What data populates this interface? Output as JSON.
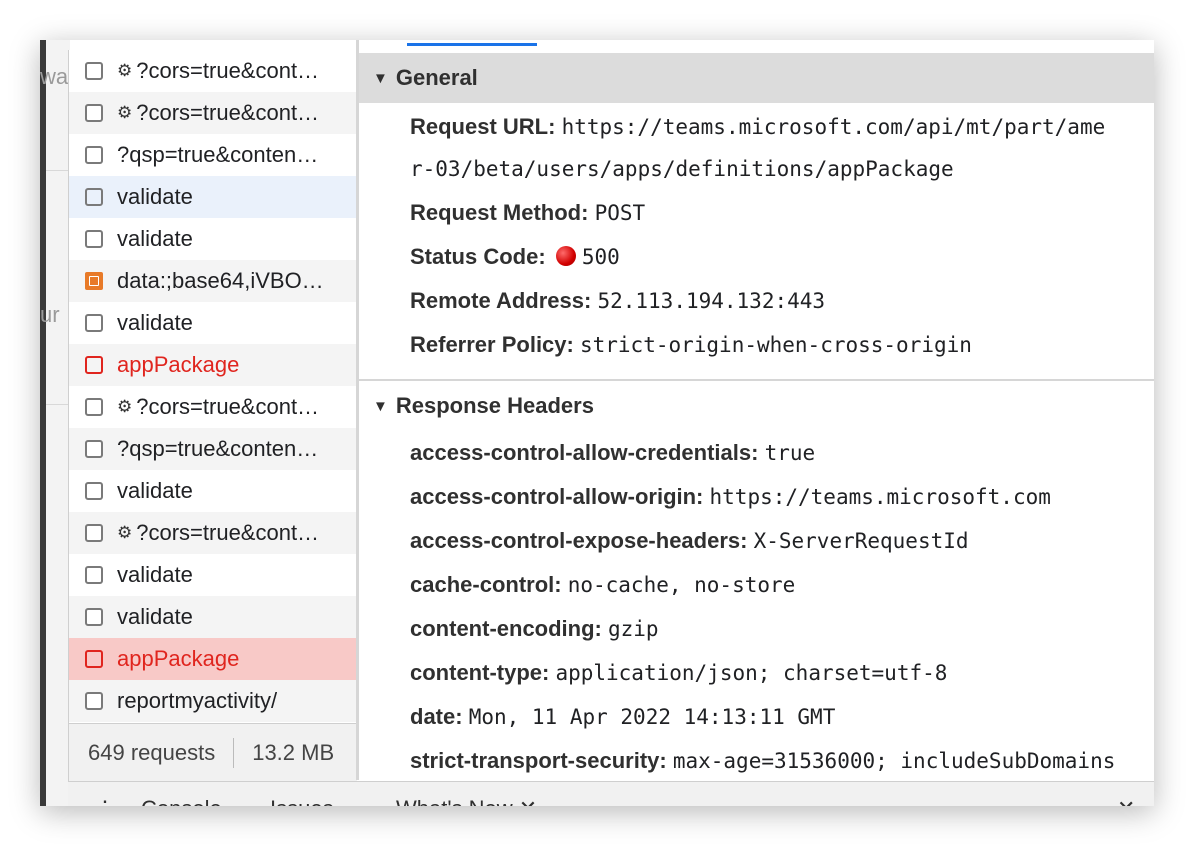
{
  "background": {
    "frag_top": "wa",
    "frag_mid": "ur"
  },
  "request_list": [
    {
      "label": "?cors=true&cont…",
      "gear": true,
      "style": "normal"
    },
    {
      "label": "?cors=true&cont…",
      "gear": true,
      "style": "alt"
    },
    {
      "label": "?qsp=true&conten…",
      "gear": false,
      "style": "normal"
    },
    {
      "label": "validate",
      "gear": false,
      "style": "hover"
    },
    {
      "label": "validate",
      "gear": false,
      "style": "normal"
    },
    {
      "label": "data:;base64,iVBO…",
      "gear": false,
      "style": "alt",
      "image": true
    },
    {
      "label": "validate",
      "gear": false,
      "style": "normal"
    },
    {
      "label": "appPackage",
      "gear": false,
      "style": "err-alt"
    },
    {
      "label": "?cors=true&cont…",
      "gear": true,
      "style": "normal"
    },
    {
      "label": "?qsp=true&conten…",
      "gear": false,
      "style": "alt"
    },
    {
      "label": "validate",
      "gear": false,
      "style": "normal"
    },
    {
      "label": "?cors=true&cont…",
      "gear": true,
      "style": "alt"
    },
    {
      "label": "validate",
      "gear": false,
      "style": "normal"
    },
    {
      "label": "validate",
      "gear": false,
      "style": "alt"
    },
    {
      "label": "appPackage",
      "gear": false,
      "style": "err-sel"
    },
    {
      "label": "reportmyactivity/",
      "gear": false,
      "style": "alt"
    }
  ],
  "status_bar": {
    "requests": "649 requests",
    "size": "13.2 MB"
  },
  "general": {
    "title": "General",
    "request_url_label": "Request URL:",
    "request_url_line1": "https://teams.microsoft.com/api/mt/part/ame",
    "request_url_line2": "r-03/beta/users/apps/definitions/appPackage",
    "request_method_label": "Request Method:",
    "request_method": "POST",
    "status_code_label": "Status Code:",
    "status_code": "500",
    "remote_address_label": "Remote Address:",
    "remote_address": "52.113.194.132:443",
    "referrer_policy_label": "Referrer Policy:",
    "referrer_policy": "strict-origin-when-cross-origin"
  },
  "response_headers": {
    "title": "Response Headers",
    "items": [
      {
        "key": "access-control-allow-credentials:",
        "value": "true"
      },
      {
        "key": "access-control-allow-origin:",
        "value": "https://teams.microsoft.com"
      },
      {
        "key": "access-control-expose-headers:",
        "value": "X-ServerRequestId"
      },
      {
        "key": "cache-control:",
        "value": "no-cache, no-store"
      },
      {
        "key": "content-encoding:",
        "value": "gzip"
      },
      {
        "key": "content-type:",
        "value": "application/json; charset=utf-8"
      },
      {
        "key": "date:",
        "value": "Mon, 11 Apr 2022 14:13:11 GMT"
      },
      {
        "key": "strict-transport-security:",
        "value": "max-age=31536000; includeSubDomains"
      }
    ]
  },
  "drawer": {
    "menu": "⋮",
    "console": "Console",
    "issues": "Issues",
    "whats_new": "What's New",
    "tab_close": "✕",
    "drawer_close": "✕"
  },
  "icons": {
    "gear": "⚙",
    "collapse_triangle": "▼"
  },
  "colors": {
    "error_red": "#e0251e",
    "selected_error_bg": "#f8c9c7",
    "tab_accent": "#1a73e8"
  }
}
